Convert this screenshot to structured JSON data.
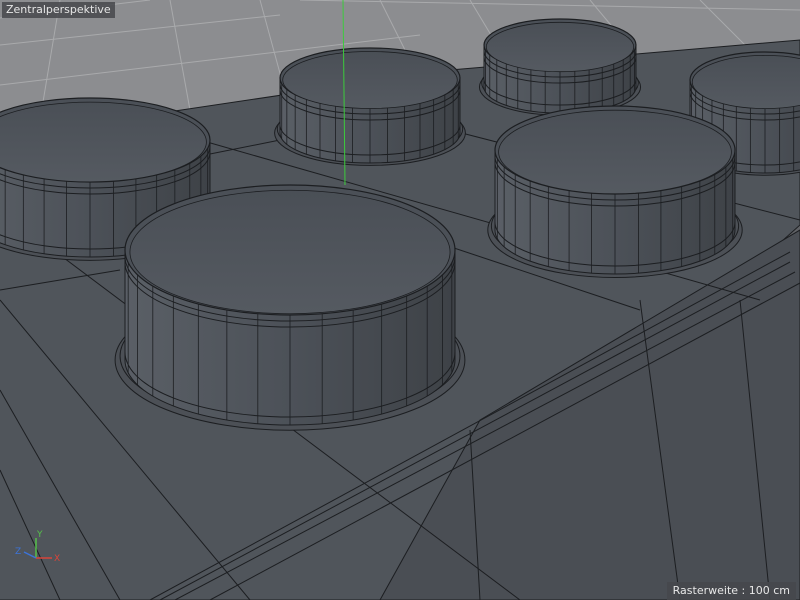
{
  "viewport": {
    "name": "Zentralperspektive",
    "grid_spacing_label": "Rasterweite : 100 cm"
  },
  "axes": {
    "x": {
      "label": "X",
      "color": "#d8453a"
    },
    "y": {
      "label": "Y",
      "color": "#55c04a"
    },
    "z": {
      "label": "Z",
      "color": "#3c73d8"
    }
  },
  "colors": {
    "background": "#606266",
    "floor": "#8a8b8e",
    "floor_grid": "#a9aaac",
    "mesh_face": "#52575d",
    "mesh_edge": "#1c1e21",
    "y_axis_line": "#3ccb3c"
  }
}
